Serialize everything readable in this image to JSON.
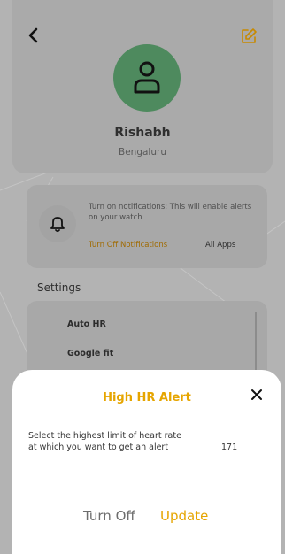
{
  "header": {
    "back_icon": "chevron-left-icon",
    "edit_icon": "pencil-square-icon"
  },
  "profile": {
    "avatar_icon": "user-icon",
    "name": "Rishabh",
    "city": "Bengaluru"
  },
  "notifications": {
    "bell_icon": "bell-icon",
    "message": "Turn on notifications: This will enable alerts on your watch",
    "turn_off_label": "Turn Off Notifications",
    "all_apps_label": "All Apps"
  },
  "settings": {
    "title": "Settings",
    "items": [
      {
        "label": "Auto HR"
      },
      {
        "label": "Google fit"
      }
    ]
  },
  "alert_sheet": {
    "title": "High HR Alert",
    "close_icon": "close-icon",
    "description": "Select the highest limit of heart rate at which you want to get an alert",
    "value": "171",
    "turn_off_label": "Turn Off",
    "update_label": "Update"
  },
  "colors": {
    "accent": "#e6a500",
    "avatar_green": "#4e8a5e",
    "overlay": "#b3b3b3"
  }
}
